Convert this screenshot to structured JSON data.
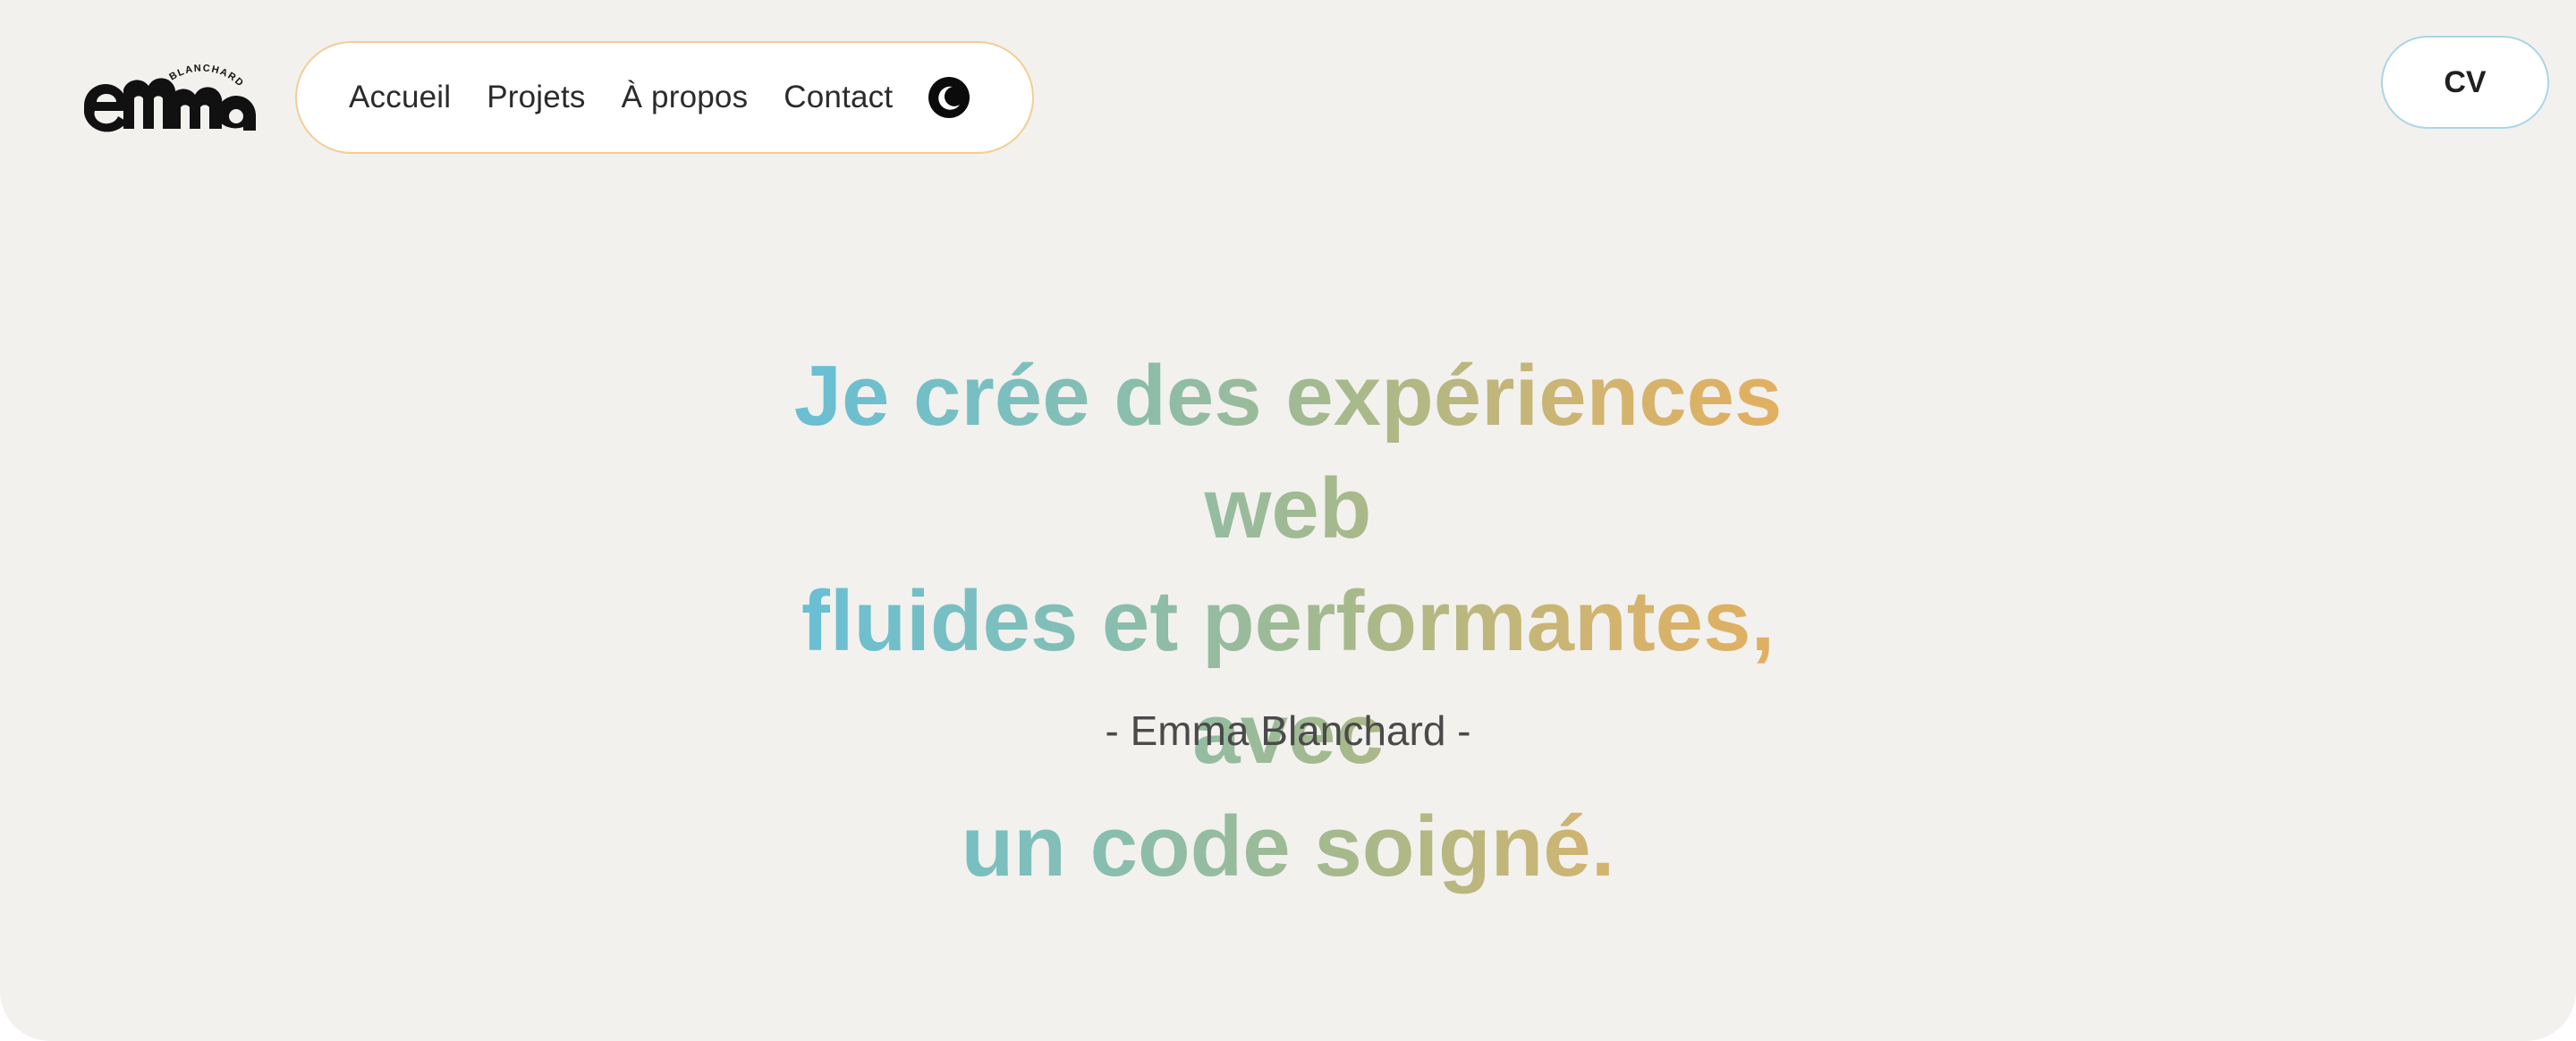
{
  "brand": {
    "logo_text": "emma",
    "logo_subtext": "BLANCHARD"
  },
  "nav": {
    "items": [
      {
        "label": "Accueil"
      },
      {
        "label": "Projets"
      },
      {
        "label": "À propos"
      },
      {
        "label": "Contact"
      }
    ],
    "theme_toggle_icon": "moon-icon"
  },
  "cv_button": {
    "label": "CV"
  },
  "hero": {
    "lines": [
      "Je crée des expériences web",
      "fluides et performantes, avec",
      "un code soigné."
    ],
    "author": "- Emma Blanchard -"
  },
  "colors": {
    "background": "#f2f1ee",
    "gradient_start": "#62bfdc",
    "gradient_end": "#e8ae5a",
    "nav_border": "#f3cd96",
    "cv_border": "#a9d6e6"
  }
}
